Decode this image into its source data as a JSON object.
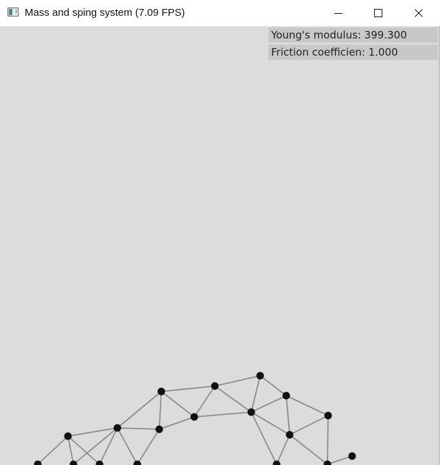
{
  "window": {
    "title": "Mass and sping system (7.09 FPS)",
    "icons": {
      "app": "app-window-icon",
      "minimize": "minimize-icon",
      "maximize": "maximize-icon",
      "close": "close-icon"
    }
  },
  "parameters": {
    "youngs_modulus_label": "Young's modulus: 399.300",
    "friction_label": "Friction coefficien: 1.000"
  },
  "colors": {
    "background": "#dcdcdc",
    "label_background": "#c8c8c8",
    "spring": "#8c8c8c",
    "mass": "#111111"
  }
}
